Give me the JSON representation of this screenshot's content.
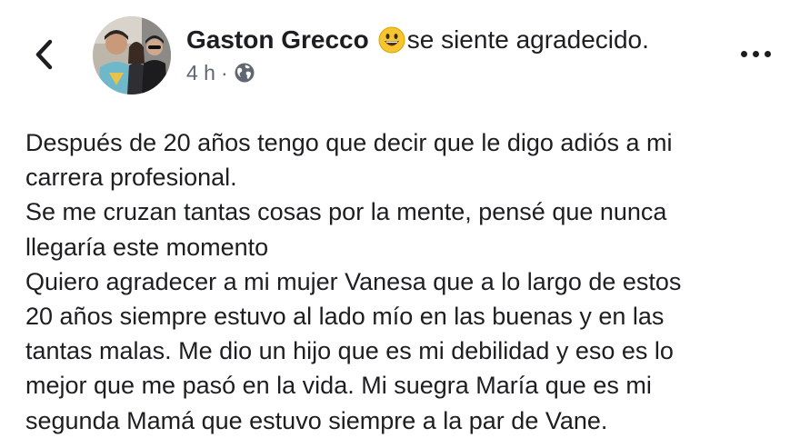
{
  "header": {
    "author_name": "Gaston Grecco",
    "feeling_emoji": "smiling-face-emoji",
    "feeling_text": "se siente agradecido.",
    "time": "4 h",
    "separator": "·",
    "audience_icon": "globe-icon",
    "back_icon": "chevron-left-icon",
    "more_icon": "more-options-icon"
  },
  "post": {
    "lines": [
      "Después de 20 años tengo que decir que le digo adiós a mi",
      "carrera profesional.",
      "Se me cruzan tantas cosas por la mente, pensé que nunca",
      "llegaría este momento",
      "Quiero agradecer a mi mujer Vanesa que a lo largo de estos",
      "20 años siempre estuvo al lado mío en las buenas y en las",
      "tantas malas. Me dio un hijo que es mi debilidad y eso es lo",
      "mejor que me pasó en la vida. Mi suegra María que es mi",
      "segunda Mamá que estuvo siempre a la par de Vane."
    ]
  },
  "colors": {
    "text": "#1c1e21",
    "meta": "#606770",
    "background": "#ffffff",
    "emoji_yellow": "#f7c52f"
  }
}
